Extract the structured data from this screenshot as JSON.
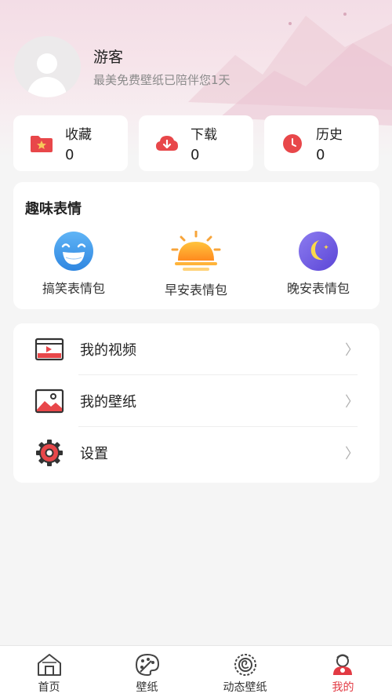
{
  "profile": {
    "name": "游客",
    "subtitle": "最美免费壁纸已陪伴您1天"
  },
  "stats": [
    {
      "label": "收藏",
      "count": "0",
      "icon": "star-folder-icon"
    },
    {
      "label": "下载",
      "count": "0",
      "icon": "download-cloud-icon"
    },
    {
      "label": "历史",
      "count": "0",
      "icon": "clock-icon"
    }
  ],
  "fun": {
    "title": "趣味表情",
    "items": [
      {
        "label": "搞笑表情包",
        "icon": "laughing-face-icon"
      },
      {
        "label": "早安表情包",
        "icon": "sunrise-icon"
      },
      {
        "label": "晚安表情包",
        "icon": "moon-icon"
      }
    ]
  },
  "menu": [
    {
      "label": "我的视频",
      "icon": "video-icon",
      "arrow": "〉"
    },
    {
      "label": "我的壁纸",
      "icon": "picture-icon",
      "arrow": "〉"
    },
    {
      "label": "设置",
      "icon": "gear-icon",
      "arrow": "〉"
    }
  ],
  "tabs": [
    {
      "label": "首页",
      "icon": "home-icon"
    },
    {
      "label": "壁纸",
      "icon": "palette-icon"
    },
    {
      "label": "动态壁纸",
      "icon": "spiral-icon"
    },
    {
      "label": "我的",
      "icon": "profile-icon",
      "active": true
    }
  ],
  "colors": {
    "accent": "#e23a43",
    "background": "#f5f5f5",
    "card": "#ffffff"
  }
}
